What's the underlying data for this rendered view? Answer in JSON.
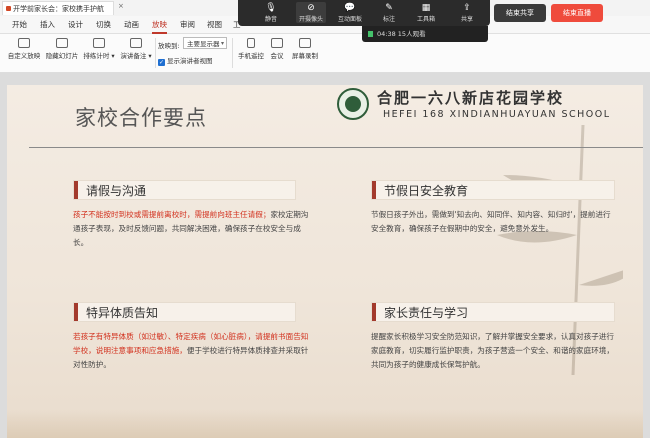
{
  "window": {
    "tab_title": "开学前家长会：家校携手护航",
    "tab_close": "×"
  },
  "menu": [
    "开始",
    "插入",
    "设计",
    "切换",
    "动画",
    "放映",
    "审阅",
    "视图",
    "工"
  ],
  "menu_active_index": 5,
  "ribbon": {
    "left_buttons": [
      "自定义放映",
      "隐藏幻灯片",
      "排练计时 ▾",
      "演讲备注 ▾"
    ],
    "show_on_label": "放映到:",
    "show_on_value": "主要显示器",
    "presenter_view_label": "显示演讲者视图",
    "right_buttons": [
      "手机遥控",
      "会议",
      "屏幕录制"
    ]
  },
  "meeting_bar": {
    "buttons": [
      {
        "label": "静音",
        "icon": "microphone-icon",
        "glyph": "🎙"
      },
      {
        "label": "开摄像头",
        "icon": "camera-off-icon",
        "glyph": "⊘"
      },
      {
        "label": "互动面板",
        "icon": "chat-icon",
        "glyph": "💬"
      },
      {
        "label": "标注",
        "icon": "pen-icon",
        "glyph": "✎"
      },
      {
        "label": "工具箱",
        "icon": "toolbox-icon",
        "glyph": "▦"
      },
      {
        "label": "共享",
        "icon": "share-icon",
        "glyph": "⇪"
      }
    ],
    "end_share": "结束共享",
    "end_live": "结束直播",
    "live_status": "04:38  15人观看"
  },
  "slide": {
    "title": "家校合作要点",
    "school_cn": "合肥一六八新店花园学校",
    "school_en": "HEFEI 168 XINDIANHUAYUAN SCHOOL",
    "sections": [
      {
        "heading": "请假与沟通",
        "red": "孩子不能按时到校或需提前离校时，需提前向班主任请假；",
        "text": "家校定期沟通孩子表现，及时反馈问题，共同解决困难，确保孩子在校安全与成长。"
      },
      {
        "heading": "节假日安全教育",
        "red": "",
        "text": "节假日孩子外出，需做到'知去向、知同伴、知内容、知归时'，提前进行安全教育，确保孩子在假期中的安全，避免意外发生。"
      },
      {
        "heading": "特异体质告知",
        "red": "若孩子有特异体质（如过敏）、特定疾病（如心脏病），请提前书面告知学校，说明注意事项和应急措施，",
        "text": "便于学校进行特异体质排查并采取针对性防护。"
      },
      {
        "heading": "家长责任与学习",
        "red": "",
        "text": "提醒家长积极学习安全防范知识，了解并掌握安全要求，认真对孩子进行家庭教育，切实履行监护职责，为孩子营造一个安全、和谐的家庭环境，共同为孩子的健康成长保驾护航。"
      }
    ]
  }
}
